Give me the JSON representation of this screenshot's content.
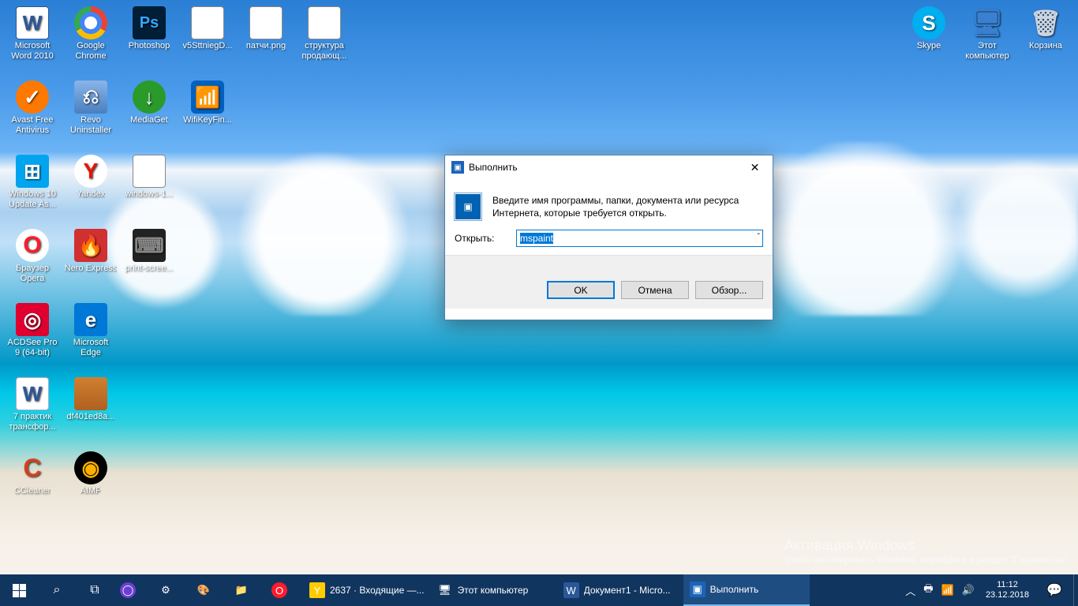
{
  "desktop_icons_left": [
    [
      {
        "label": "Microsoft Word 2010",
        "iconClass": "ic-word",
        "glyph": "W",
        "name": "icon-word"
      },
      {
        "label": "Google Chrome",
        "iconClass": "ic-chrome",
        "glyph": "",
        "name": "icon-chrome"
      },
      {
        "label": "Photoshop",
        "iconClass": "ic-ps",
        "glyph": "Ps",
        "name": "icon-photoshop"
      },
      {
        "label": "v5SttniegD...",
        "iconClass": "ic-img",
        "glyph": "",
        "name": "icon-file-v5"
      },
      {
        "label": "патчи.png",
        "iconClass": "ic-img",
        "glyph": "",
        "name": "icon-file-patchi"
      },
      {
        "label": "структура продающ...",
        "iconClass": "ic-img",
        "glyph": "",
        "name": "icon-file-struktura"
      }
    ],
    [
      {
        "label": "Avast Free Antivirus",
        "iconClass": "ic-avast",
        "glyph": "✓",
        "name": "icon-avast"
      },
      {
        "label": "Revo Uninstaller",
        "iconClass": "ic-revo",
        "glyph": "⎌",
        "name": "icon-revo"
      },
      {
        "label": "MediaGet",
        "iconClass": "ic-mediaget",
        "glyph": "↓",
        "name": "icon-mediaget"
      },
      {
        "label": "WifiKeyFin...",
        "iconClass": "ic-wifi",
        "glyph": "📶",
        "name": "icon-wifikey"
      }
    ],
    [
      {
        "label": "Windows 10 Update As...",
        "iconClass": "ic-win",
        "glyph": "⊞",
        "name": "icon-winupdate"
      },
      {
        "label": "Yandex",
        "iconClass": "ic-yandex",
        "glyph": "Y",
        "name": "icon-yandex"
      },
      {
        "label": "windows-1...",
        "iconClass": "ic-img",
        "glyph": "",
        "name": "icon-file-windows1"
      }
    ],
    [
      {
        "label": "Браузер Opera",
        "iconClass": "ic-opera",
        "glyph": "O",
        "name": "icon-opera"
      },
      {
        "label": "Nero Express",
        "iconClass": "ic-nero",
        "glyph": "🔥",
        "name": "icon-nero"
      },
      {
        "label": "print-scree...",
        "iconClass": "ic-kb",
        "glyph": "⌨",
        "name": "icon-file-printscreen"
      }
    ],
    [
      {
        "label": "ACDSee Pro 9 (64-bit)",
        "iconClass": "ic-acd",
        "glyph": "◎",
        "name": "icon-acdsee"
      },
      {
        "label": "Microsoft Edge",
        "iconClass": "ic-edge",
        "glyph": "e",
        "name": "icon-edge"
      }
    ],
    [
      {
        "label": "7 практик трансфор...",
        "iconClass": "ic-doc",
        "glyph": "W",
        "name": "icon-file-7praktik"
      },
      {
        "label": "df401ed8a...",
        "iconClass": "ic-tbl",
        "glyph": "",
        "name": "icon-file-df401"
      }
    ],
    [
      {
        "label": "CCleaner",
        "iconClass": "ic-cc",
        "glyph": "C",
        "name": "icon-ccleaner"
      },
      {
        "label": "AIMP",
        "iconClass": "ic-aimp",
        "glyph": "◉",
        "name": "icon-aimp"
      }
    ]
  ],
  "desktop_icons_right": [
    {
      "label": "Skype",
      "iconClass": "ic-skype",
      "glyph": "S",
      "name": "icon-skype"
    },
    {
      "label": "Этот компьютер",
      "iconClass": "ic-pc",
      "glyph": "🖥",
      "name": "icon-thispc"
    },
    {
      "label": "Корзина",
      "iconClass": "ic-bin",
      "glyph": "🗑",
      "name": "icon-recyclebin"
    }
  ],
  "run_dialog": {
    "title": "Выполнить",
    "description": "Введите имя программы, папки, документа или ресурса Интернета, которые требуется открыть.",
    "open_label": "Открыть:",
    "input_value": "mspaint",
    "buttons": {
      "ok": "OK",
      "cancel": "Отмена",
      "browse": "Обзор..."
    }
  },
  "watermark": {
    "title": "Активация Windows",
    "line": "Чтобы активировать Windows, перейдите в раздел \"Параметры\"."
  },
  "taskbar": {
    "pinned": [
      {
        "name": "tb-cortana-circle",
        "glyph": "◯",
        "bg": "#6b3fd1"
      },
      {
        "name": "tb-settings",
        "glyph": "⚙",
        "bg": "transparent"
      },
      {
        "name": "tb-paint",
        "glyph": "🎨",
        "bg": "transparent"
      },
      {
        "name": "tb-explorer",
        "glyph": "📁",
        "bg": "transparent"
      },
      {
        "name": "tb-opera",
        "glyph": "O",
        "bg": "#ff1b2d"
      }
    ],
    "tasks": [
      {
        "name": "tb-task-yandex",
        "iconGlyph": "Y",
        "iconBg": "#ffcc00",
        "label": "2637 · Входящие —...",
        "active": false
      },
      {
        "name": "tb-task-thispc",
        "iconGlyph": "🖥",
        "iconBg": "transparent",
        "label": "Этот компьютер",
        "active": false
      },
      {
        "name": "tb-task-word",
        "iconGlyph": "W",
        "iconBg": "#2b579a",
        "label": "Документ1 - Micro...",
        "active": false
      },
      {
        "name": "tb-task-run",
        "iconGlyph": "▣",
        "iconBg": "#1b64b8",
        "label": "Выполнить",
        "active": true
      }
    ],
    "tray": {
      "chevron": "︿",
      "bt": "🖶",
      "wifi": "📶",
      "vol": "🔊",
      "lang": ""
    },
    "clock": {
      "time": "11:12",
      "date": "23.12.2018"
    }
  }
}
